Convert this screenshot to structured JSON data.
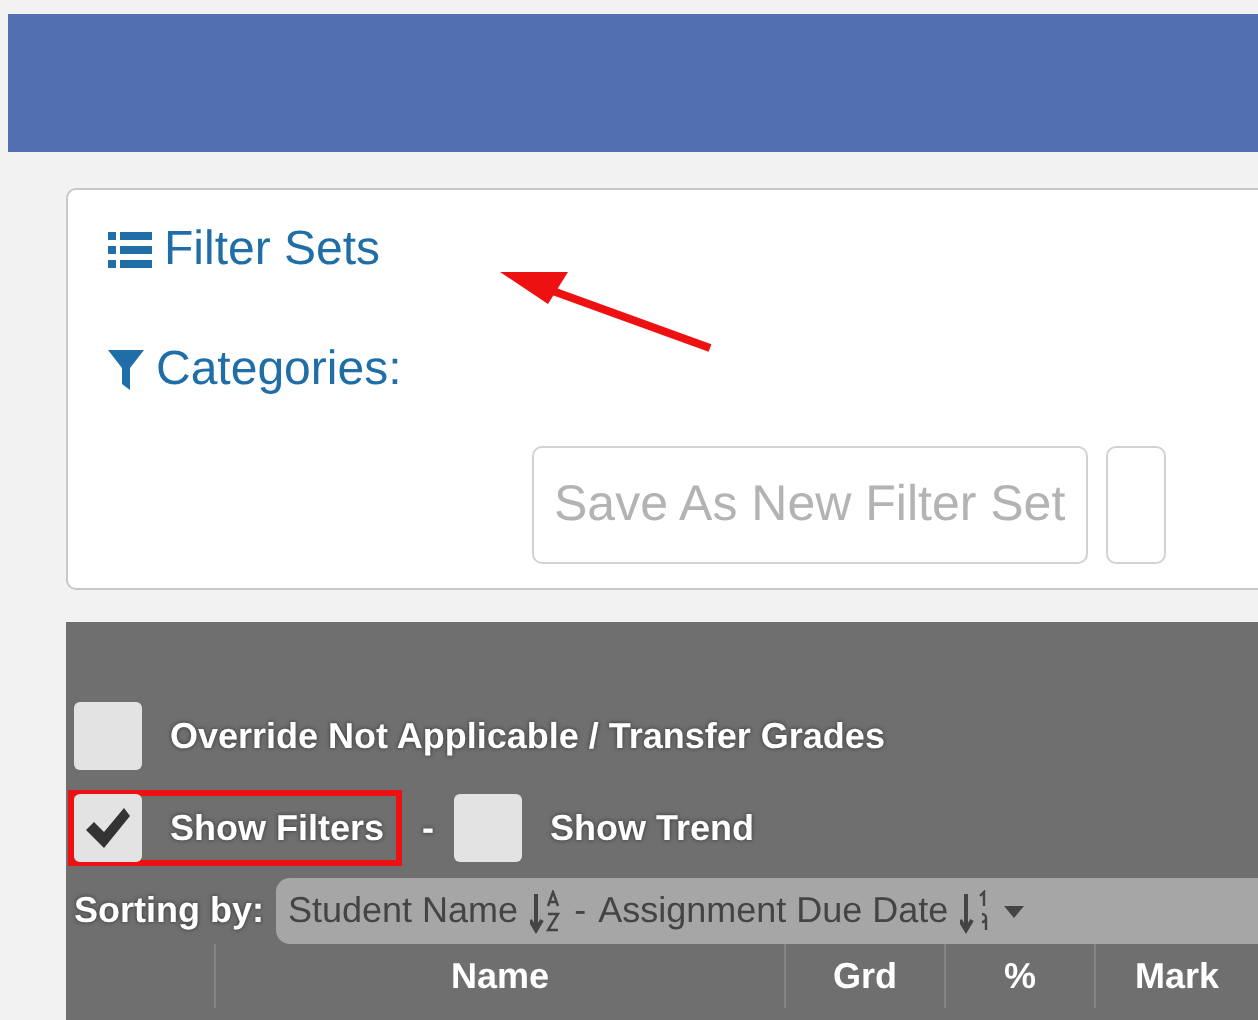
{
  "filter_panel": {
    "filter_sets_link": "Filter Sets",
    "annotation_arrow": true,
    "categories_label": "Categories:",
    "buttons": [
      {
        "label": "Save As New Filter Set",
        "disabled": true
      }
    ]
  },
  "options": [
    {
      "label": "Override Not Applicable / Transfer Grades",
      "checked": false,
      "highlighted": false
    }
  ],
  "view_options": [
    {
      "label": "Show Filters",
      "checked": true,
      "highlighted": true
    },
    {
      "label": "Show Trend",
      "checked": false,
      "highlighted": false
    }
  ],
  "view_separator": "-",
  "sorting": {
    "label": "Sorting by:",
    "separator": "-",
    "keys": [
      {
        "name": "Student Name",
        "kind": "alpha"
      },
      {
        "name": "Assignment Due Date",
        "kind": "numeric"
      }
    ]
  },
  "table": {
    "columns": [
      "Name",
      "Grd",
      "%",
      "Mark"
    ]
  }
}
